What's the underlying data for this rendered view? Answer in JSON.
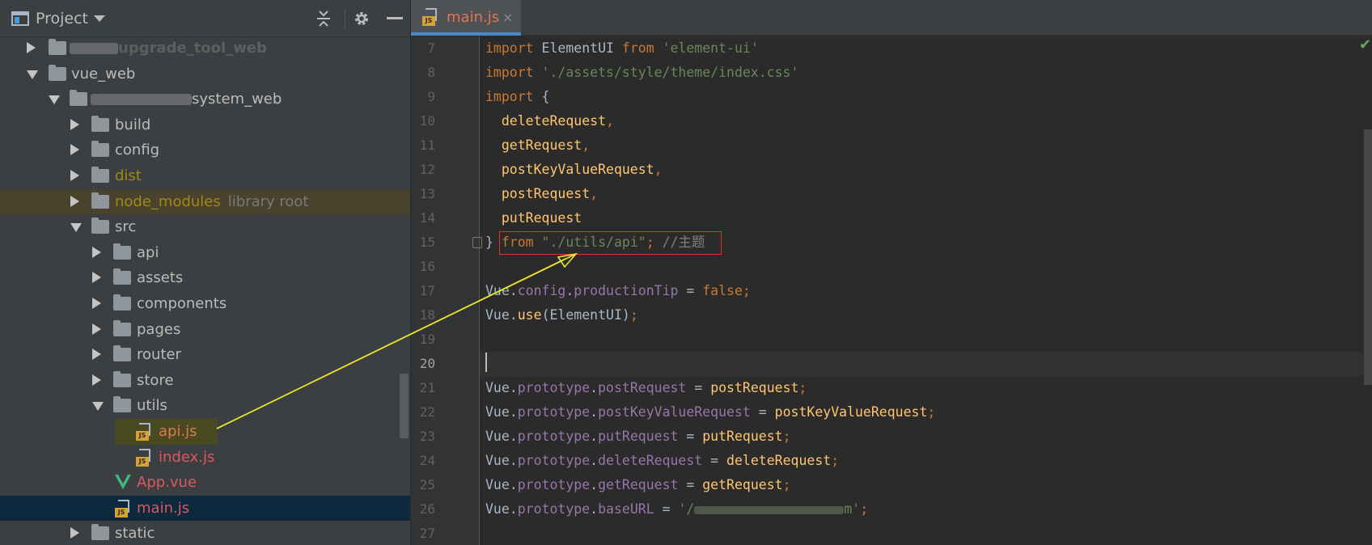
{
  "project": {
    "title": "Project",
    "tree": [
      {
        "label": "upgrade_tool_web",
        "blurred": true
      },
      {
        "label": "vue_web"
      },
      {
        "label": "system_web",
        "blurred": true
      },
      {
        "label": "build"
      },
      {
        "label": "config"
      },
      {
        "label": "dist"
      },
      {
        "label": "node_modules",
        "hint": "library root"
      },
      {
        "label": "src"
      },
      {
        "label": "api"
      },
      {
        "label": "assets"
      },
      {
        "label": "components"
      },
      {
        "label": "pages"
      },
      {
        "label": "router"
      },
      {
        "label": "store"
      },
      {
        "label": "utils"
      },
      {
        "label": "api.js"
      },
      {
        "label": "index.js"
      },
      {
        "label": "App.vue"
      },
      {
        "label": "main.js"
      },
      {
        "label": "static"
      }
    ]
  },
  "editor": {
    "tab": {
      "label": "main.js",
      "close": "×"
    },
    "line_numbers": [
      "7",
      "8",
      "9",
      "10",
      "11",
      "12",
      "13",
      "14",
      "15",
      "16",
      "17",
      "18",
      "19",
      "20",
      "21",
      "22",
      "23",
      "24",
      "25",
      "26",
      "27"
    ],
    "current_line": "20",
    "code": {
      "l7": {
        "a": "import ",
        "b": "ElementUI ",
        "c": "from ",
        "d": "'element-ui'"
      },
      "l8": {
        "a": "import ",
        "d": "'./assets/style/theme/index.css'"
      },
      "l9": {
        "a": "import ",
        "b": "{"
      },
      "l10": {
        "b": "  deleteRequest",
        "p": ","
      },
      "l11": {
        "b": "  getRequest",
        "p": ","
      },
      "l12": {
        "b": "  postKeyValueRequest",
        "p": ","
      },
      "l13": {
        "b": "  postRequest",
        "p": ","
      },
      "l14": {
        "b": "  putRequest"
      },
      "l15": {
        "b": "} ",
        "c": "from ",
        "d": "\"./utils/api\"",
        "p": "; ",
        "m": "//主题"
      },
      "l17": {
        "v": "Vue",
        "dot": ".",
        "pr1": "config",
        "dot2": ".",
        "pr2": "productionTip",
        "eq": " = ",
        "kw": "false",
        "sc": ";"
      },
      "l18": {
        "v": "Vue",
        "dot": ".",
        "fn": "use",
        "arg": "(ElementUI)",
        "sc": ";"
      },
      "l21": {
        "v": "Vue",
        "dot": ".",
        "pr1": "prototype",
        "dot2": ".",
        "pr2": "postRequest",
        "eq": " = ",
        "val": "postRequest",
        "sc": ";"
      },
      "l22": {
        "v": "Vue",
        "dot": ".",
        "pr1": "prototype",
        "dot2": ".",
        "pr2": "postKeyValueRequest",
        "eq": " = ",
        "val": "postKeyValueRequest",
        "sc": ";"
      },
      "l23": {
        "v": "Vue",
        "dot": ".",
        "pr1": "prototype",
        "dot2": ".",
        "pr2": "putRequest",
        "eq": " = ",
        "val": "putRequest",
        "sc": ";"
      },
      "l24": {
        "v": "Vue",
        "dot": ".",
        "pr1": "prototype",
        "dot2": ".",
        "pr2": "deleteRequest",
        "eq": " = ",
        "val": "deleteRequest",
        "sc": ";"
      },
      "l25": {
        "v": "Vue",
        "dot": ".",
        "pr1": "prototype",
        "dot2": ".",
        "pr2": "getRequest",
        "eq": " = ",
        "val": "getRequest",
        "sc": ";"
      },
      "l26": {
        "v": "Vue",
        "dot": ".",
        "pr1": "prototype",
        "dot2": ".",
        "pr2": "baseURL",
        "eq": " = ",
        "s1": "'/",
        "s2": "m'",
        "sc": ";"
      }
    }
  },
  "colors": {
    "annotation_arrow": "#e8e62a",
    "annotation_box": "#e03030",
    "selection": "#0d293e",
    "keyword": "#cc7832",
    "string": "#6a8759"
  }
}
